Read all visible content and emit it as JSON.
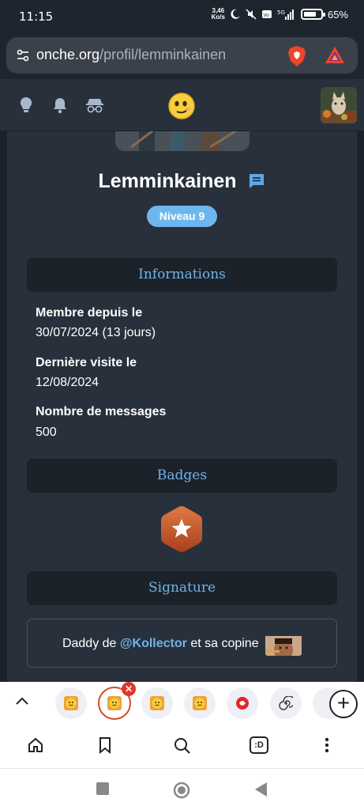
{
  "status": {
    "time": "11:15",
    "speed_value": "3,46",
    "speed_unit": "Ko/s",
    "battery": "65%"
  },
  "browser": {
    "url_host": "onche.org",
    "url_path": "/profil/lemminkainen"
  },
  "header": {
    "icons": [
      "lightbulb-icon",
      "bell-icon",
      "incognito-icon"
    ],
    "logo": "smiley-icon"
  },
  "profile": {
    "username": "Lemminkainen",
    "level": "Niveau 9",
    "informations_title": "Informations",
    "member_since_label": "Membre depuis le",
    "member_since_value": "30/07/2024 (13 jours)",
    "last_visit_label": "Dernière visite le",
    "last_visit_value": "12/08/2024",
    "messages_label": "Nombre de messages",
    "messages_value": "500",
    "badges_title": "Badges",
    "signature_title": "Signature",
    "signature_prefix": "Daddy de",
    "signature_mention": "@Kollector",
    "signature_suffix": "et sa copine"
  },
  "emojibar": {
    "close_badge": "✕",
    "add_label": "+"
  },
  "bottomnav": {
    "tabs_label": ":D"
  },
  "colors": {
    "accent": "#6fb4ea",
    "card": "#28303b",
    "section": "#1c222a",
    "badge": "#c85a2e",
    "level": "#6eb7ee"
  }
}
